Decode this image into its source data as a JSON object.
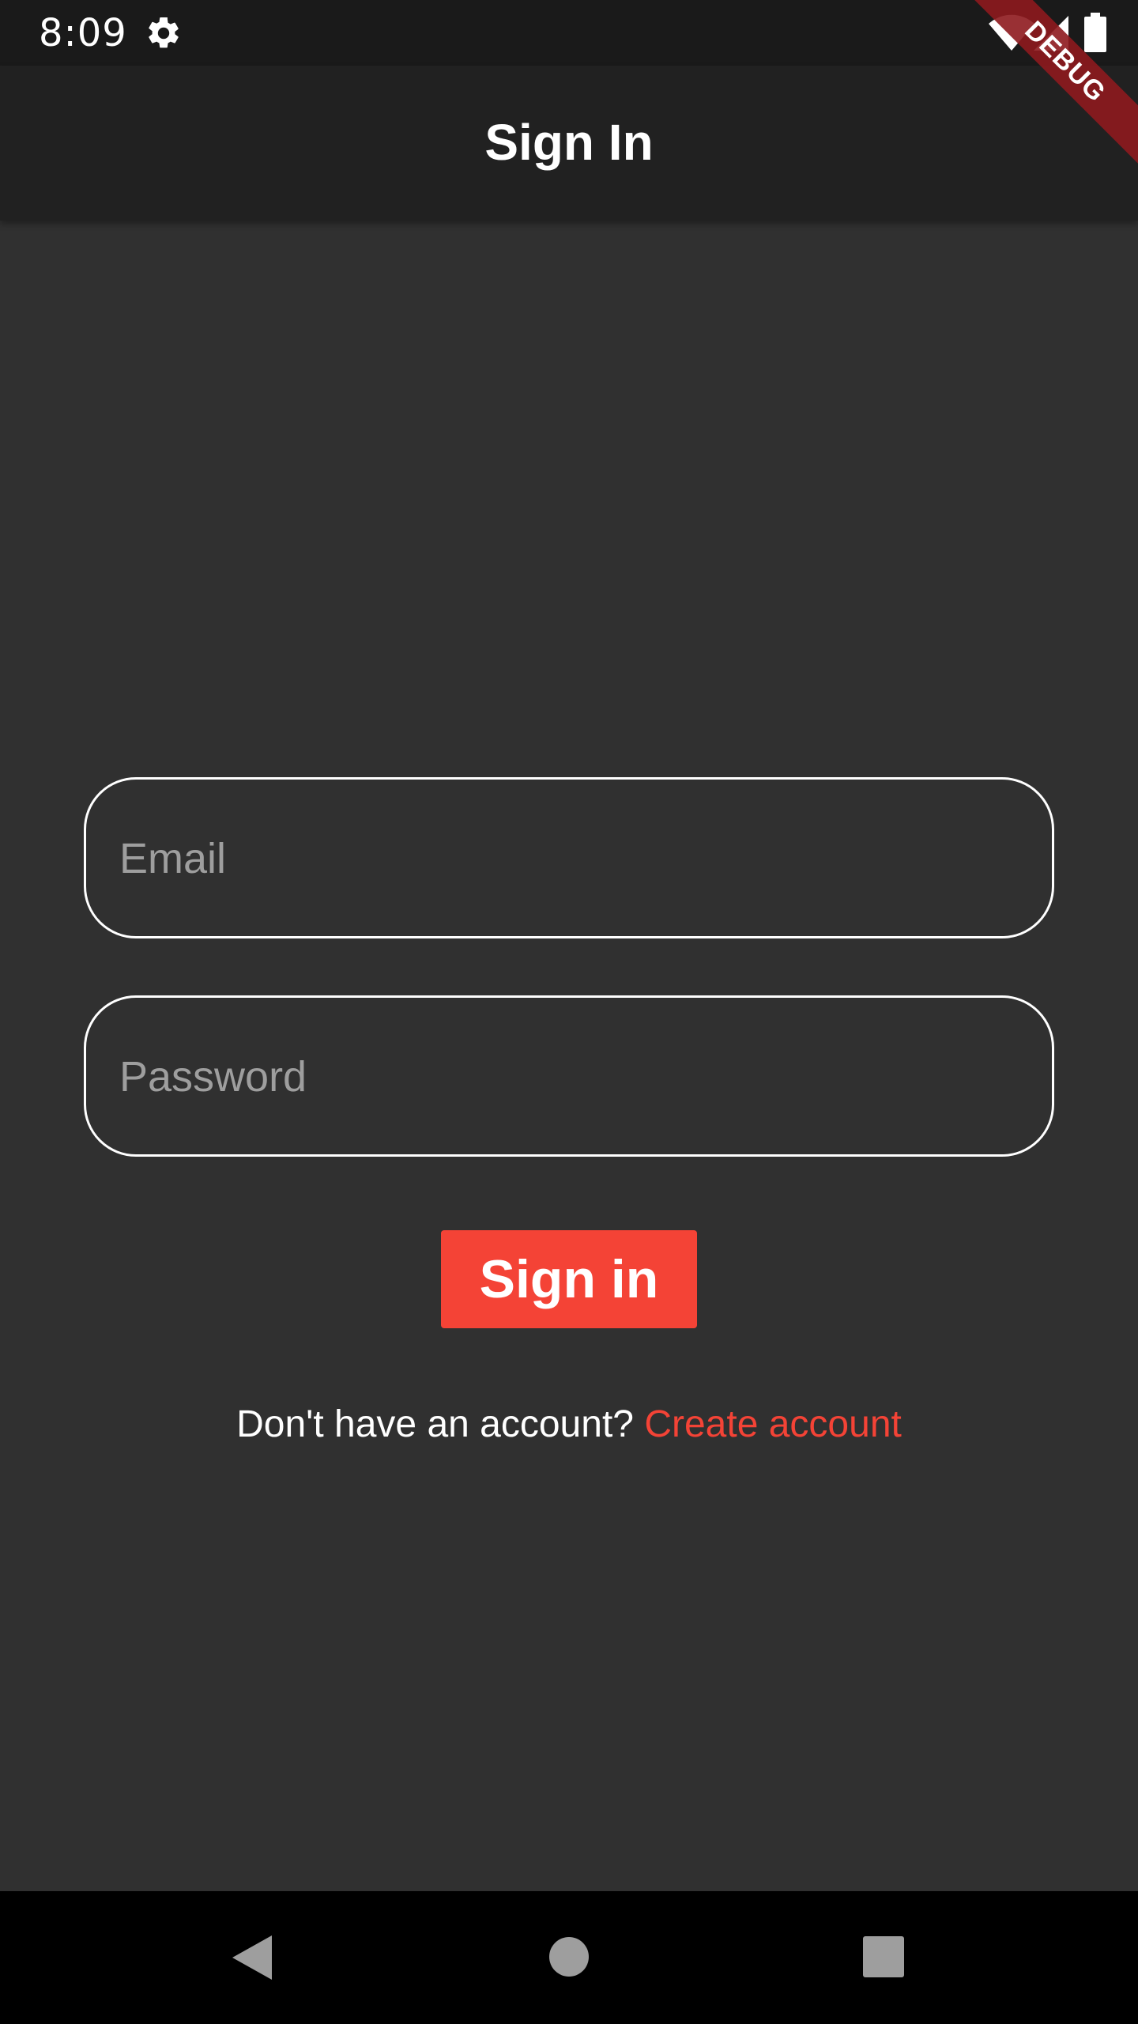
{
  "status_bar": {
    "time": "8:09",
    "icons": [
      "gear-icon",
      "wifi-icon",
      "signal-icon",
      "battery-icon"
    ]
  },
  "debug_banner": {
    "label": "DEBUG"
  },
  "app_bar": {
    "title": "Sign In"
  },
  "form": {
    "email": {
      "placeholder": "Email",
      "value": ""
    },
    "password": {
      "placeholder": "Password",
      "value": ""
    },
    "submit_label": "Sign in"
  },
  "account": {
    "prompt": "Don't have an account?",
    "link_label": "Create account"
  },
  "nav_bar": {
    "icons": [
      "back-icon",
      "home-icon",
      "recent-apps-icon"
    ]
  },
  "colors": {
    "accent": "#f44336",
    "background": "#303030",
    "app_bar": "#212121",
    "status_bar": "#1a1a1a",
    "nav_bar": "#000000"
  }
}
